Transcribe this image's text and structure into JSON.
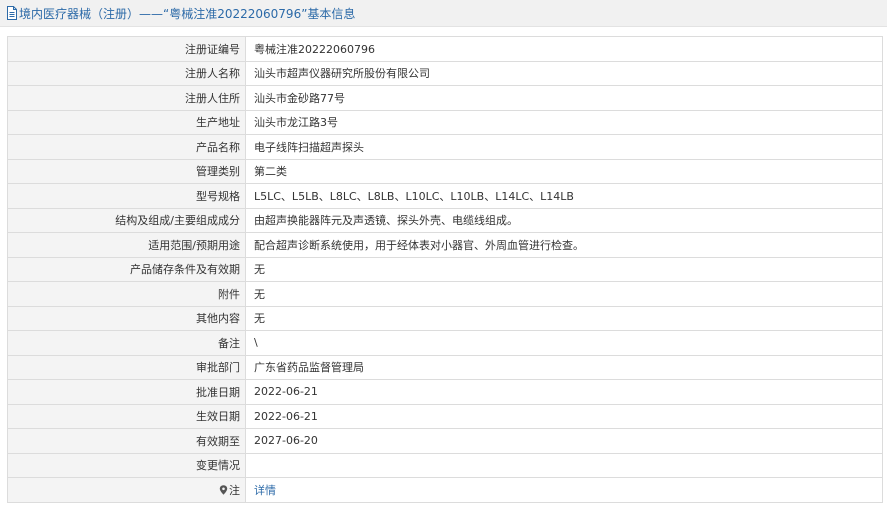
{
  "header": {
    "title": "境内医疗器械（注册）——“粤械注准20222060796”基本信息"
  },
  "rows": [
    {
      "label": "注册证编号",
      "value": "粤械注准20222060796"
    },
    {
      "label": "注册人名称",
      "value": "汕头市超声仪器研究所股份有限公司"
    },
    {
      "label": "注册人住所",
      "value": "汕头市金砂路77号"
    },
    {
      "label": "生产地址",
      "value": "汕头市龙江路3号"
    },
    {
      "label": "产品名称",
      "value": "电子线阵扫描超声探头"
    },
    {
      "label": "管理类别",
      "value": "第二类"
    },
    {
      "label": "型号规格",
      "value": "L5LC、L5LB、L8LC、L8LB、L10LC、L10LB、L14LC、L14LB"
    },
    {
      "label": "结构及组成/主要组成成分",
      "value": "由超声换能器阵元及声透镜、探头外壳、电缆线组成。"
    },
    {
      "label": "适用范围/预期用途",
      "value": "配合超声诊断系统使用，用于经体表对小器官、外周血管进行检查。"
    },
    {
      "label": "产品储存条件及有效期",
      "value": "无"
    },
    {
      "label": "附件",
      "value": "无"
    },
    {
      "label": "其他内容",
      "value": "无"
    },
    {
      "label": "备注",
      "value": "\\"
    },
    {
      "label": "审批部门",
      "value": "广东省药品监督管理局"
    },
    {
      "label": "批准日期",
      "value": "2022-06-21"
    },
    {
      "label": "生效日期",
      "value": "2022-06-21"
    },
    {
      "label": "有效期至",
      "value": "2027-06-20"
    },
    {
      "label": "变更情况",
      "value": ""
    }
  ],
  "note_row": {
    "label": "注",
    "link_text": "详情"
  },
  "icons": {
    "title_icon": "document-icon",
    "note_icon": "location-pin-icon"
  },
  "colors": {
    "title_text": "#2c6aa8",
    "link": "#2c6aa8",
    "label_bg": "#f4f4f4",
    "border": "#dcdcdc"
  }
}
